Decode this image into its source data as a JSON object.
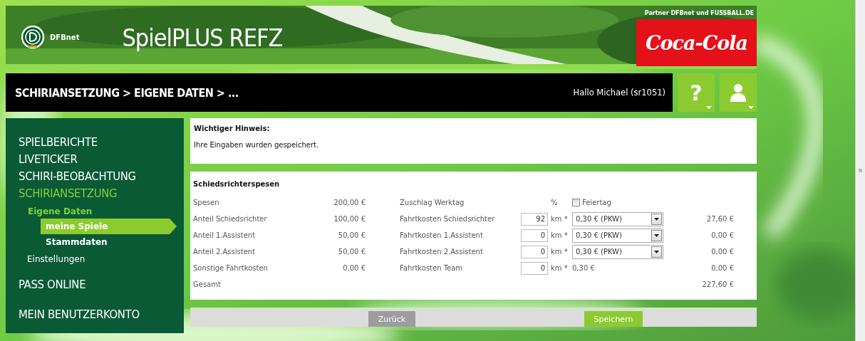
{
  "header": {
    "brand": "DFBnet",
    "app_title": "SpielPLUS REFZ",
    "partner_note": "Partner DFBnet und FUSSBALL.DE",
    "sponsor_logo": "Coca-Cola"
  },
  "navbar": {
    "breadcrumb": "SCHIRIANSETZUNG > EIGENE DATEN > ...",
    "greeting": "Hallo Michael (sr1051)",
    "buttons": [
      {
        "kind": "help",
        "label": "?"
      },
      {
        "kind": "user"
      }
    ]
  },
  "sidebar": {
    "items": [
      {
        "label": "SPIELBERICHTE",
        "active": false,
        "selected": false
      },
      {
        "label": "LIVETICKER",
        "active": false,
        "selected": false
      },
      {
        "label": "SCHIRI-BEOBACHTUNG",
        "active": false,
        "selected": false
      },
      {
        "label": "SCHIRIANSETZUNG",
        "active": true,
        "selected": false,
        "children": [
          {
            "label": "Eigene Daten",
            "active": true,
            "selected": false,
            "children": [
              {
                "label": "meine Spiele",
                "active": false,
                "selected": true
              },
              {
                "label": "Stammdaten",
                "active": false,
                "selected": false
              }
            ]
          },
          {
            "label": "Einstellungen",
            "active": false,
            "selected": false
          }
        ]
      },
      {
        "label": "PASS ONLINE",
        "active": false,
        "selected": false
      },
      {
        "label": "MEIN BENUTZERKONTO",
        "active": false,
        "selected": false
      }
    ]
  },
  "notice": {
    "title": "Wichtiger Hinweis:",
    "message": "Ihre Eingaben wurden gespeichert."
  },
  "expenses": {
    "title": "Schiedsrichterspesen",
    "rows": [
      {
        "label": "Spesen",
        "value": "200,00 €",
        "right": {
          "kind": "surcharge",
          "label": "Zuschlag Werktag",
          "unit": "%",
          "checkbox": {
            "label": "Feiertag",
            "checked": false
          }
        }
      },
      {
        "label": "Anteil Schiedsrichter",
        "value": "100,00 €",
        "right": {
          "kind": "select",
          "label": "Fahrtkosten Schiedsrichter",
          "km": "92",
          "unit": "km *",
          "rate": "0,30 € (PKW)",
          "amount": "27,60 €"
        }
      },
      {
        "label": "Anteil 1.Assistent",
        "value": "50,00 €",
        "right": {
          "kind": "select",
          "label": "Fahrtkosten 1.Assistent",
          "km": "0",
          "unit": "km *",
          "rate": "0,30 € (PKW)",
          "amount": "0,00 €"
        }
      },
      {
        "label": "Anteil 2.Assistent",
        "value": "50,00 €",
        "right": {
          "kind": "select",
          "label": "Fahrtkosten 2.Assistent",
          "km": "0",
          "unit": "km *",
          "rate": "0,30 € (PKW)",
          "amount": "0,00 €"
        }
      },
      {
        "label": "Sonstige Fahrtkosten",
        "value": "0,00 €",
        "right": {
          "kind": "fixed",
          "label": "Fahrtkosten Team",
          "km": "0",
          "unit": "km *",
          "rate": "0,30 €",
          "amount": "0,00 €"
        }
      }
    ],
    "total": {
      "label": "Gesamt",
      "amount": "227,60 €"
    }
  },
  "actions": [
    {
      "kind": "secondary",
      "label": "Zurück"
    },
    {
      "kind": "primary",
      "label": "Speichern"
    }
  ]
}
